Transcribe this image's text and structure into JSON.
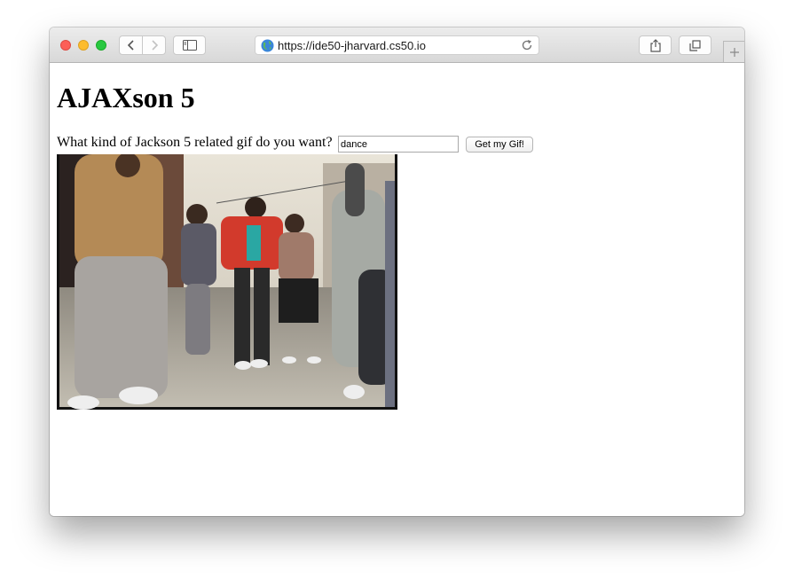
{
  "browser": {
    "url": "https://ide50-jharvard.cs50.io",
    "icons": {
      "back": "chevron-left-icon",
      "forward": "chevron-right-icon",
      "sidebar": "sidebar-icon",
      "share": "share-icon",
      "tabs": "tab-overview-icon",
      "new_tab": "plus-icon",
      "site": "globe-icon",
      "reload": "reload-icon"
    },
    "colors": {
      "close": "#fc5f57",
      "minimize": "#fdbc2e",
      "maximize": "#28c840"
    }
  },
  "page": {
    "heading": "AJAXson 5",
    "prompt": "What kind of Jackson 5 related gif do you want?",
    "search": {
      "value": "dance",
      "button_label": "Get my Gif!"
    },
    "result": {
      "kind": "animated gif",
      "subject": "people dancing in the street"
    }
  }
}
